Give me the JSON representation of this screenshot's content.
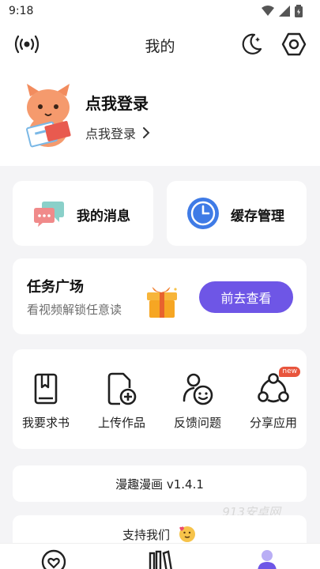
{
  "status_bar": {
    "time": "9:18",
    "icons": [
      "wifi-icon",
      "signal-icon",
      "battery-icon"
    ]
  },
  "header": {
    "title": "我的",
    "left_icon": "broadcast-icon",
    "right_icons": [
      "moon-icon",
      "settings-hexagon-icon"
    ]
  },
  "profile": {
    "title": "点我登录",
    "subtitle": "点我登录",
    "chevron": "›"
  },
  "quick_cards": [
    {
      "label": "我的消息",
      "icon": "message-bubbles-icon"
    },
    {
      "label": "缓存管理",
      "icon": "clock-icon"
    }
  ],
  "task": {
    "title": "任务广场",
    "subtitle": "看视频解锁任意读",
    "button": "前去查看",
    "icon": "gift-box-icon"
  },
  "tools": [
    {
      "label": "我要求书",
      "icon": "book-request-icon"
    },
    {
      "label": "上传作品",
      "icon": "upload-file-icon"
    },
    {
      "label": "反馈问题",
      "icon": "feedback-person-icon"
    },
    {
      "label": "分享应用",
      "icon": "share-icon",
      "badge": "new"
    }
  ],
  "version": "漫趣漫画 v1.4.1",
  "watermark": "913安卓网",
  "support": {
    "label": "支持我们",
    "icon": "heart-emoji-icon"
  },
  "bottom_nav": [
    "heart-home-icon",
    "bookshelf-icon",
    "profile-icon"
  ],
  "colors": {
    "accent": "#6e56e6",
    "clock_blue": "#3f7be6",
    "gift_orange": "#f6a623",
    "background": "#f4f4f6"
  }
}
